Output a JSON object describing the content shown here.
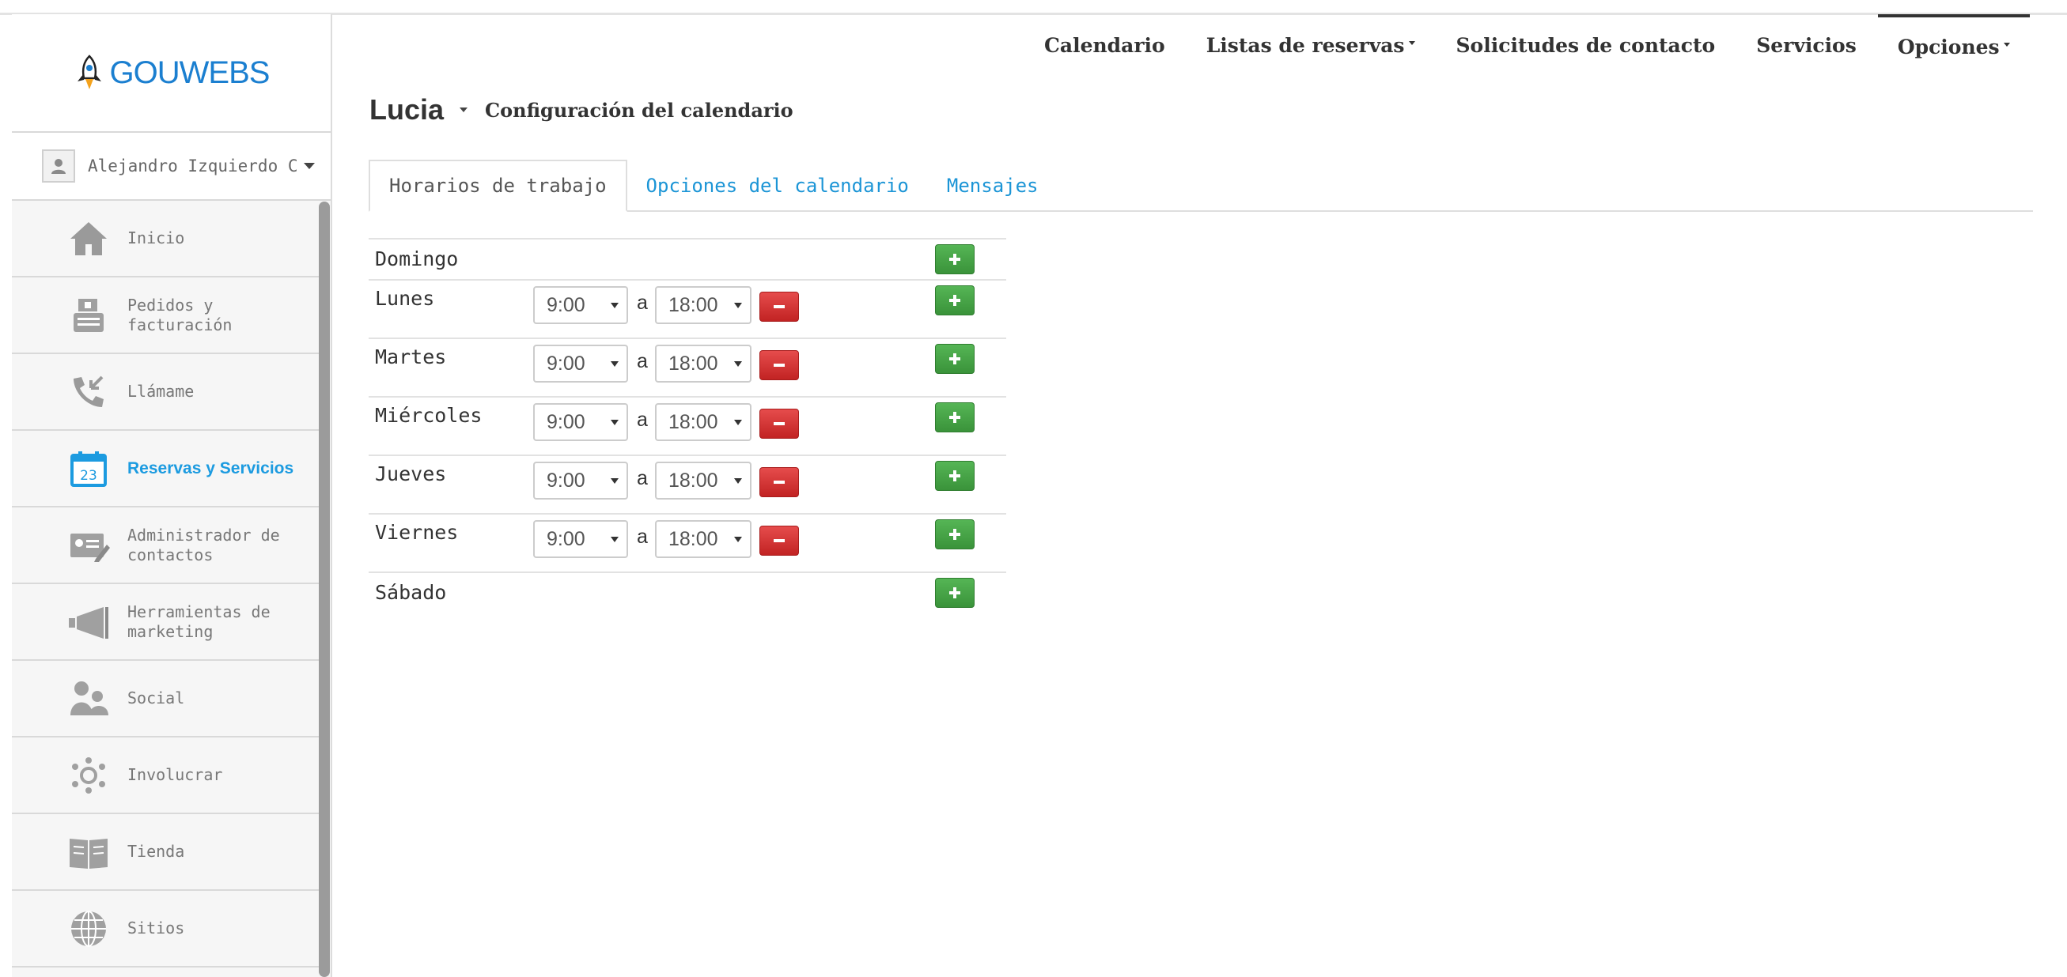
{
  "brand": {
    "logo_text": "GOUWEBS"
  },
  "user": {
    "name": "Alejandro Izquierdo Cli"
  },
  "sidebar": {
    "items": [
      {
        "label": "Inicio",
        "icon": "home-icon"
      },
      {
        "label": "Pedidos y facturación",
        "icon": "cash-register-icon"
      },
      {
        "label": "Llámame",
        "icon": "phone-icon"
      },
      {
        "label": "Reservas y Servicios",
        "icon": "calendar-icon",
        "active": true
      },
      {
        "label": "Administrador de contactos",
        "icon": "contact-card-icon"
      },
      {
        "label": "Herramientas de marketing",
        "icon": "megaphone-icon"
      },
      {
        "label": "Social",
        "icon": "people-icon"
      },
      {
        "label": "Involucrar",
        "icon": "network-icon"
      },
      {
        "label": "Tienda",
        "icon": "book-icon"
      },
      {
        "label": "Sitios",
        "icon": "globe-icon"
      }
    ]
  },
  "topnav": {
    "items": [
      "Calendario",
      "Listas de reservas",
      "Solicitudes de contacto",
      "Servicios",
      "Opciones"
    ]
  },
  "heading": {
    "name": "Lucia",
    "subtitle": "Configuración del calendario"
  },
  "tabs": [
    "Horarios de trabajo",
    "Opciones del calendario",
    "Mensajes"
  ],
  "schedule": {
    "separator": "a",
    "days": [
      {
        "day": "Domingo"
      },
      {
        "day": "Lunes",
        "from": "9:00",
        "to": "18:00"
      },
      {
        "day": "Martes",
        "from": "9:00",
        "to": "18:00"
      },
      {
        "day": "Miércoles",
        "from": "9:00",
        "to": "18:00"
      },
      {
        "day": "Jueves",
        "from": "9:00",
        "to": "18:00"
      },
      {
        "day": "Viernes",
        "from": "9:00",
        "to": "18:00"
      },
      {
        "day": "Sábado"
      }
    ]
  },
  "colors": {
    "accent": "#1c9be0",
    "add": "#48a948",
    "remove": "#d43a3a"
  }
}
